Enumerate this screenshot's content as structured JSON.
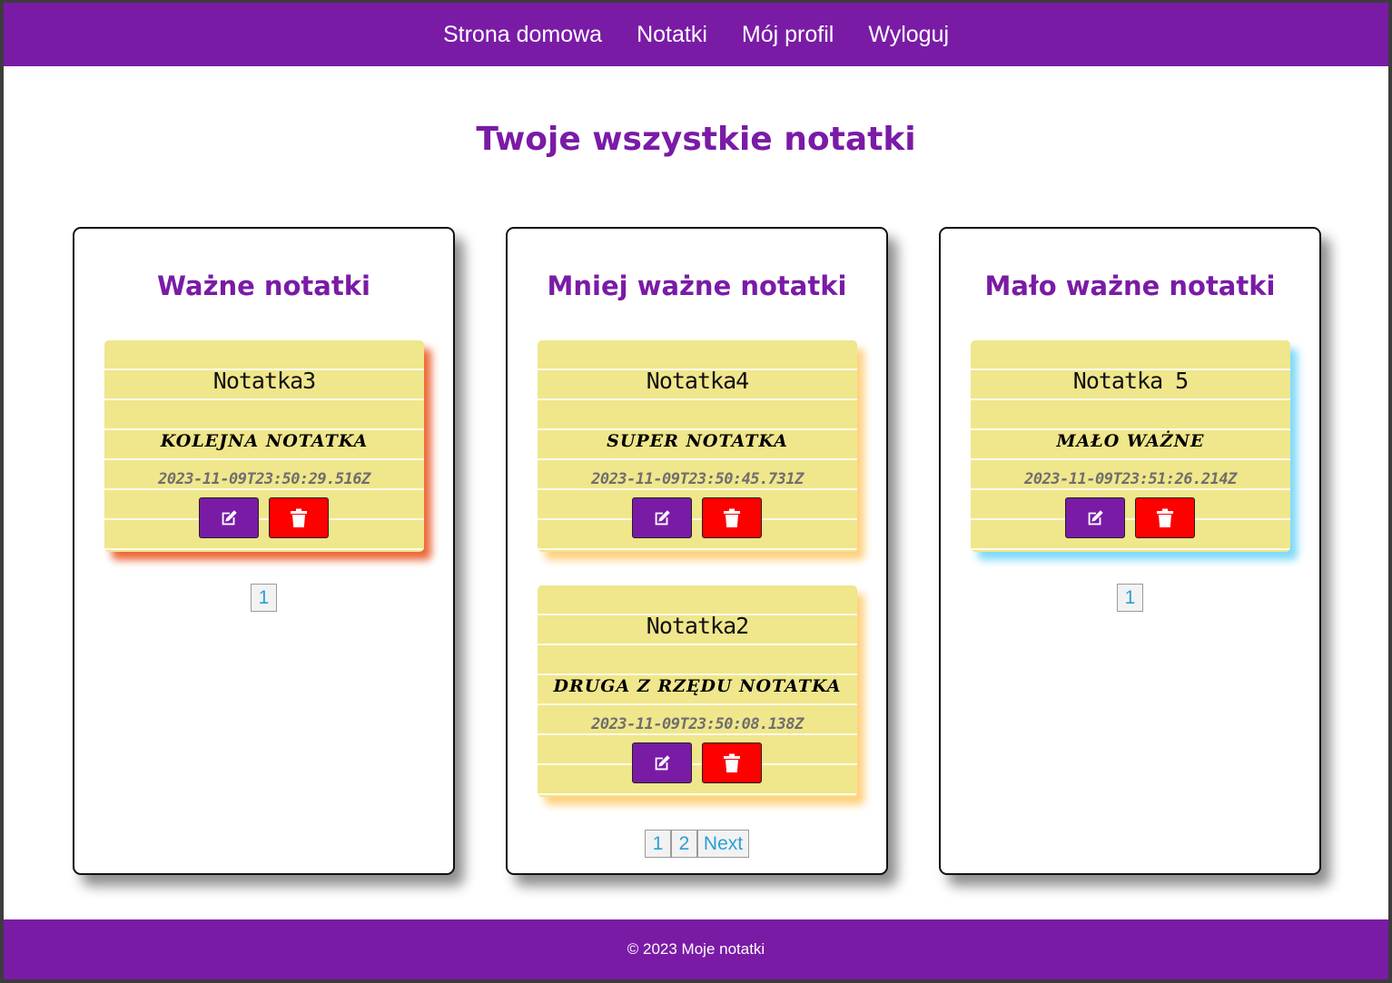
{
  "nav": {
    "home": "Strona domowa",
    "notes": "Notatki",
    "profile": "Mój profil",
    "logout": "Wyloguj"
  },
  "page_title": "Twoje wszystkie notatki",
  "columns": [
    {
      "title": "Ważne notatki",
      "notes": [
        {
          "title": "Notatka3",
          "content": "Kolejna notatka",
          "date": "2023-11-09T23:50:29.516Z"
        }
      ],
      "pagination": [
        "1"
      ]
    },
    {
      "title": "Mniej ważne notatki",
      "notes": [
        {
          "title": "Notatka4",
          "content": "Super notatka",
          "date": "2023-11-09T23:50:45.731Z"
        },
        {
          "title": "Notatka2",
          "content": "Druga z rzędu notatka",
          "date": "2023-11-09T23:50:08.138Z"
        }
      ],
      "pagination": [
        "1",
        "2",
        "Next"
      ]
    },
    {
      "title": "Mało ważne notatki",
      "notes": [
        {
          "title": "Notatka 5",
          "content": "Mało ważne",
          "date": "2023-11-09T23:51:26.214Z"
        }
      ],
      "pagination": [
        "1"
      ]
    }
  ],
  "icons": {
    "edit": "edit-icon",
    "delete": "trash-icon"
  },
  "colors": {
    "brand": "#7a1ba6",
    "note": "#f0e68c",
    "delete": "#ff0000",
    "link": "#2a9fd6"
  },
  "footer": "© 2023 Moje notatki"
}
